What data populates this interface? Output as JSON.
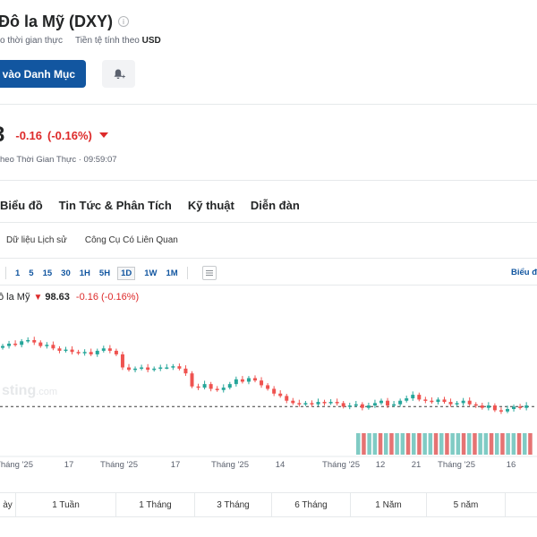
{
  "header": {
    "title": "Đô la Mỹ (DXY)",
    "meta_left": "o thời gian thực",
    "meta_currency_label": "Tiền tệ tính theo",
    "meta_currency_value": "USD"
  },
  "actions": {
    "portfolio_label": "n vào Danh Mục",
    "alert_icon": "bell-plus-icon"
  },
  "quote": {
    "last": "3",
    "change": "-0.16",
    "change_pct": "(-0.16%)",
    "realtime_text": "heo Thời Gian Thực · 09:59:07"
  },
  "main_tabs": [
    "Biểu đồ",
    "Tin Tức & Phân Tích",
    "Kỹ thuật",
    "Diễn đàn"
  ],
  "sub_tabs": [
    "Dữ liệu Lịch sử",
    "Công Cụ Có Liên Quan"
  ],
  "timeframes": [
    "1",
    "5",
    "15",
    "30",
    "1H",
    "5H",
    "1D",
    "1W",
    "1M"
  ],
  "timeframe_active": "1D",
  "chart_link": "Biểu đ",
  "legend": {
    "name": "ô la Mỹ",
    "arrow": "▼",
    "price": "98.63",
    "change": "-0.16 (-0.16%)"
  },
  "ranges": [
    "ày",
    "1 Tuần",
    "1 Tháng",
    "3 Tháng",
    "6 Tháng",
    "1 Năm",
    "5 năm"
  ],
  "colors": {
    "up": "#26a69a",
    "down": "#ef5350",
    "accent": "#1256a0",
    "neg": "#dd2a2a"
  },
  "chart_data": {
    "type": "candlestick",
    "x_tick_labels": [
      "Tháng '25",
      "17",
      "Tháng '25",
      "17",
      "Tháng '25",
      "14",
      "Tháng '25",
      "12",
      "21",
      "Tháng '25",
      "16"
    ],
    "watermark": "sting.com",
    "last_price": 98.63,
    "closes": [
      101.5,
      101.7,
      101.6,
      101.9,
      102.0,
      101.8,
      101.5,
      101.6,
      101.3,
      101.1,
      101.2,
      101.0,
      100.9,
      101.0,
      100.8,
      101.1,
      101.3,
      101.1,
      100.8,
      99.7,
      99.5,
      99.6,
      99.7,
      99.5,
      99.6,
      99.7,
      99.7,
      99.8,
      99.6,
      99.2,
      98.1,
      98.0,
      98.3,
      97.9,
      97.8,
      98.0,
      98.3,
      98.7,
      98.5,
      98.8,
      98.6,
      98.2,
      97.9,
      97.5,
      97.3,
      96.9,
      96.7,
      96.6,
      96.7,
      96.6,
      96.8,
      96.7,
      96.8,
      96.7,
      96.4,
      96.5,
      96.6,
      96.3,
      96.5,
      96.7,
      96.9,
      96.5,
      96.6,
      96.9,
      97.1,
      97.4,
      97.0,
      96.9,
      96.8,
      97.0,
      96.8,
      96.6,
      96.7,
      96.9,
      96.6,
      96.5,
      96.3,
      96.5,
      96.1,
      96.0,
      96.2,
      96.4,
      96.3,
      96.5
    ]
  }
}
